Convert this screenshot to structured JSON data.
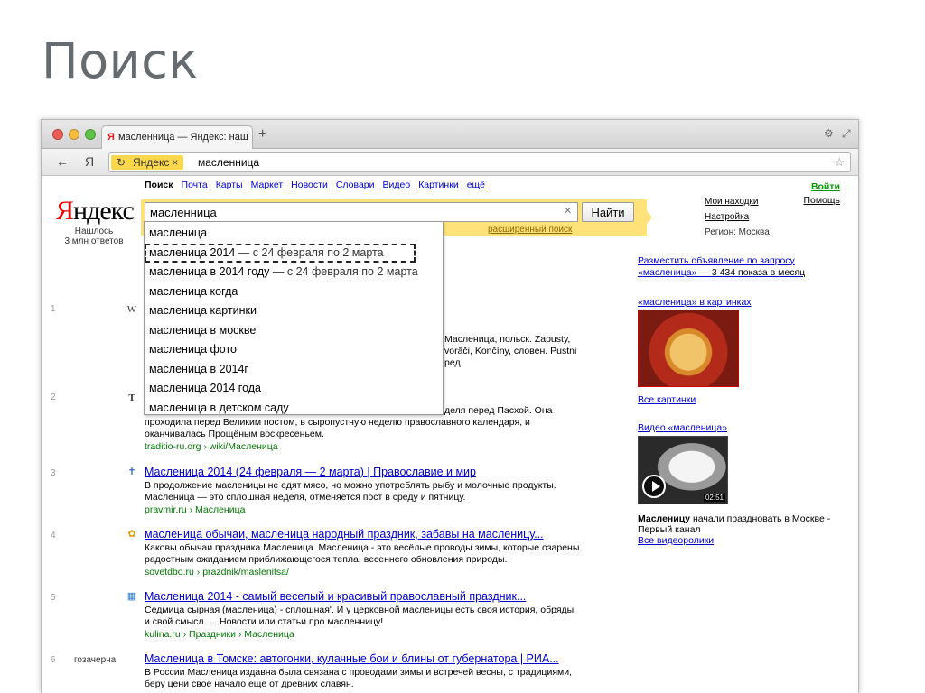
{
  "slide": {
    "title": "Поиск"
  },
  "browser": {
    "tab_title": "масленница — Яндекс: наш",
    "tab_favicon": "Я",
    "newtab_label": "+",
    "back_icon": "←",
    "ya_button": "Я",
    "address_tag": "Яндекс",
    "address_tag_close": "×",
    "address_text": "масленница",
    "star_icon": "☆"
  },
  "yandex": {
    "logo_red": "Я",
    "logo_black": "ндекс",
    "found": "Нашлось\n3 млн ответов",
    "services": [
      {
        "label": "Поиск",
        "active": true
      },
      {
        "label": "Почта"
      },
      {
        "label": "Карты"
      },
      {
        "label": "Маркет"
      },
      {
        "label": "Новости"
      },
      {
        "label": "Словари"
      },
      {
        "label": "Видео"
      },
      {
        "label": "Картинки"
      },
      {
        "label": "ещё"
      }
    ],
    "search": {
      "value": "масленница",
      "clear_icon": "✕",
      "button": "Найти",
      "advanced": "расширенный поиск"
    },
    "top_right": {
      "login": "Войти",
      "help": "Помощь"
    },
    "right_links": {
      "my_finds": "Мои находки",
      "settings": "Настройка",
      "region": "Регион: Москва"
    },
    "suggestions": [
      {
        "main": "масленица",
        "extra": ""
      },
      {
        "main": "масленица 2014",
        "extra": " — с 24 февраля по 2 марта",
        "highlight": true
      },
      {
        "main": "масленица в 2014 году",
        "extra": " — с 24 февраля по 2 марта"
      },
      {
        "main": "масленица когда",
        "extra": ""
      },
      {
        "main": "масленица картинки",
        "extra": ""
      },
      {
        "main": "масленица в москве",
        "extra": ""
      },
      {
        "main": "масленица фото",
        "extra": ""
      },
      {
        "main": "масленица в 2014г",
        "extra": ""
      },
      {
        "main": "масленица 2014 года",
        "extra": ""
      },
      {
        "main": "масленица в детском саду",
        "extra": ""
      }
    ],
    "results": [
      {
        "num": "1",
        "fav": "W",
        "partial": [
          "Масленица, польск. Zapusty,",
          "vorāči, Končíny, словен. Pustni",
          "ред."
        ]
      },
      {
        "num": "2",
        "fav": "T",
        "partial_line": "деля перед Пасхой. Она",
        "snippet": [
          "проходила перед Великим постом, в сыропустную неделю православного календаря, и",
          "оканчивалась Прощёным воскресеньем."
        ],
        "url": "traditio-ru.org › wiki/Масленица"
      },
      {
        "num": "3",
        "fav": "✝",
        "title": "Масленица 2014 (24 февраля — 2 марта) | Православие и мир",
        "snippet": [
          "В продолжение масленицы не едят мясо, но можно употреблять рыбу и молочные продукты.",
          "Масленица — это сплошная неделя, отменяется пост в среду и пятницу."
        ],
        "url": "pravmir.ru › Масленица"
      },
      {
        "num": "4",
        "fav": "✿",
        "title": "масленица обычаи, масленица народный праздник, забавы на масленицу...",
        "snippet": [
          "Каковы обычаи праздника Масленица. Масленица - это весёлые проводы зимы, которые озарены",
          "радостным ожиданием приближающегося тепла, весеннего обновления природы."
        ],
        "url": "sovetdbo.ru › prazdnik/maslenitsa/"
      },
      {
        "num": "5",
        "fav": "▦",
        "title": "Масленица 2014 - самый веселый и красивый православный праздник...",
        "snippet": [
          "Седмица сырная (масленица) - сплошная'. И у церковной масленицы есть своя история, обряды",
          "и свой смысл. ... Новости или статьи про масленницу!"
        ],
        "url": "kulina.ru › Праздники › Масленица"
      },
      {
        "num": "6",
        "side": "гозачерна",
        "title": "Масленица в Томске: автогонки, кулачные бои и блины от губернатора | РИА...",
        "snippet": [
          "В России Масленица издавна была связана с проводами зимы и встречей весны, с традициями,",
          "беру цени свое начало еще от древних славян."
        ]
      }
    ],
    "right_column": {
      "ad_title": "Разместить объявление по запросу «масленица»",
      "ad_count": " — 3 434 показа в месяц",
      "images_title": "«масленица» в картинках",
      "all_images": "Все картинки",
      "video_title": "Видео «масленица»",
      "video_duration": "02:51",
      "video_desc_bold": "Масленицу",
      "video_desc": " начали праздновать в Москве - Первый канал",
      "all_videos": "Все видеоролики"
    }
  },
  "icons": {
    "reload": "reload-icon",
    "star": "star-icon",
    "play": "play-icon",
    "clear": "clear-icon"
  }
}
